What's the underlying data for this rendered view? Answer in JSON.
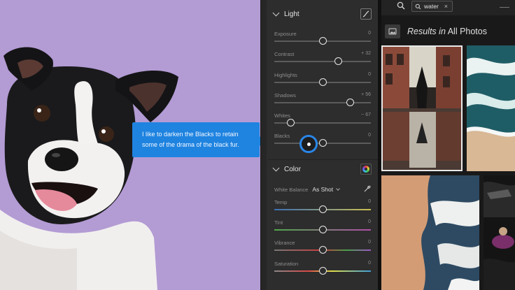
{
  "tooltip": {
    "text": "I like to darken the Blacks to retain some of the drama of the black fur."
  },
  "light_panel": {
    "title": "Light",
    "sliders": [
      {
        "label": "Exposure",
        "value": "0",
        "level": 0.5
      },
      {
        "label": "Contrast",
        "value": "+ 32",
        "level": 0.66
      },
      {
        "label": "Highlights",
        "value": "0",
        "level": 0.5
      },
      {
        "label": "Shadows",
        "value": "+ 56",
        "level": 0.78
      },
      {
        "label": "Whites",
        "value": "− 67",
        "level": 0.17
      },
      {
        "label": "Blacks",
        "value": "0",
        "level": 0.5
      }
    ]
  },
  "color_panel": {
    "title": "Color",
    "white_balance_label": "White Balance",
    "white_balance_value": "As Shot",
    "sliders": [
      {
        "label": "Temp",
        "value": "0",
        "level": 0.5
      },
      {
        "label": "Tint",
        "value": "0",
        "level": 0.5
      },
      {
        "label": "Vibrance",
        "value": "0",
        "level": 0.5
      },
      {
        "label": "Saturation",
        "value": "0",
        "level": 0.5
      }
    ]
  },
  "search": {
    "query": "water",
    "clear_symbol": "×",
    "results_prefix": "Results",
    "results_in": "in",
    "results_scope": "All Photos"
  },
  "colors": {
    "accent": "#1f83e0",
    "photo_background": "#b39bd4",
    "panel": "#2d2d2d"
  },
  "icons": [
    "search-icon",
    "tag-icon",
    "close-icon",
    "tone-curve-icon",
    "color-mixer-icon",
    "eyedropper-icon",
    "chevron-down-icon",
    "photo-grid-icon"
  ]
}
